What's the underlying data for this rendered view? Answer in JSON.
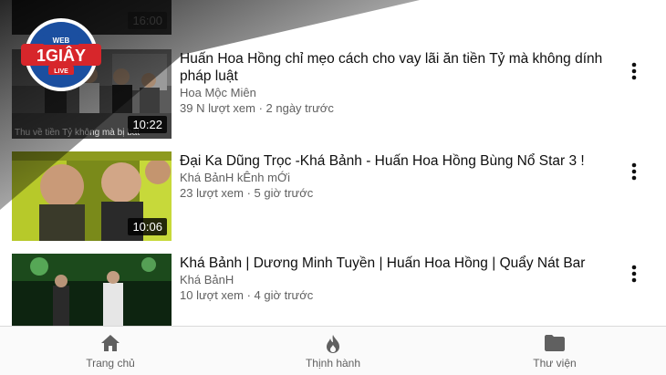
{
  "videos": [
    {
      "title": "Huấn Hoa Hồng chỉ mẹo cách cho vay lãi ăn tiền Tỷ mà không dính pháp luật",
      "channel": "Hoa Mộc Miên",
      "stats": "39 N lượt xem · 2 ngày trước",
      "duration": "10:22",
      "thumb_caption": "Thu về tiền Tỷ không mà bị bắt"
    },
    {
      "title": "Đại Ka Dũng Trọc -Khá Bảnh - Huấn Hoa Hồng Bùng Nổ Star 3 !",
      "channel": "Khá BảnH kÊnh mỚi",
      "stats": "23 lượt xem · 5 giờ trước",
      "duration": "10:06"
    },
    {
      "title": "Khá Bảnh | Dương Minh Tuyền | Huấn Hoa Hồng | Quẩy Nát Bar",
      "channel": "Khá BảnH",
      "stats": "10 lượt xem · 4 giờ trước"
    }
  ],
  "partial_duration_top": "16:00",
  "logo": {
    "top": "WEB",
    "main": "1GIÂY",
    "bottom": "LIVE"
  },
  "nav": [
    {
      "label": "Trang chủ",
      "icon": "home-icon"
    },
    {
      "label": "Thịnh hành",
      "icon": "fire-icon"
    },
    {
      "label": "Thư viện",
      "icon": "folder-icon"
    }
  ],
  "colors": {
    "logo_red": "#d7262b",
    "logo_blue": "#1b4fa0",
    "icon_gray": "#606060"
  }
}
